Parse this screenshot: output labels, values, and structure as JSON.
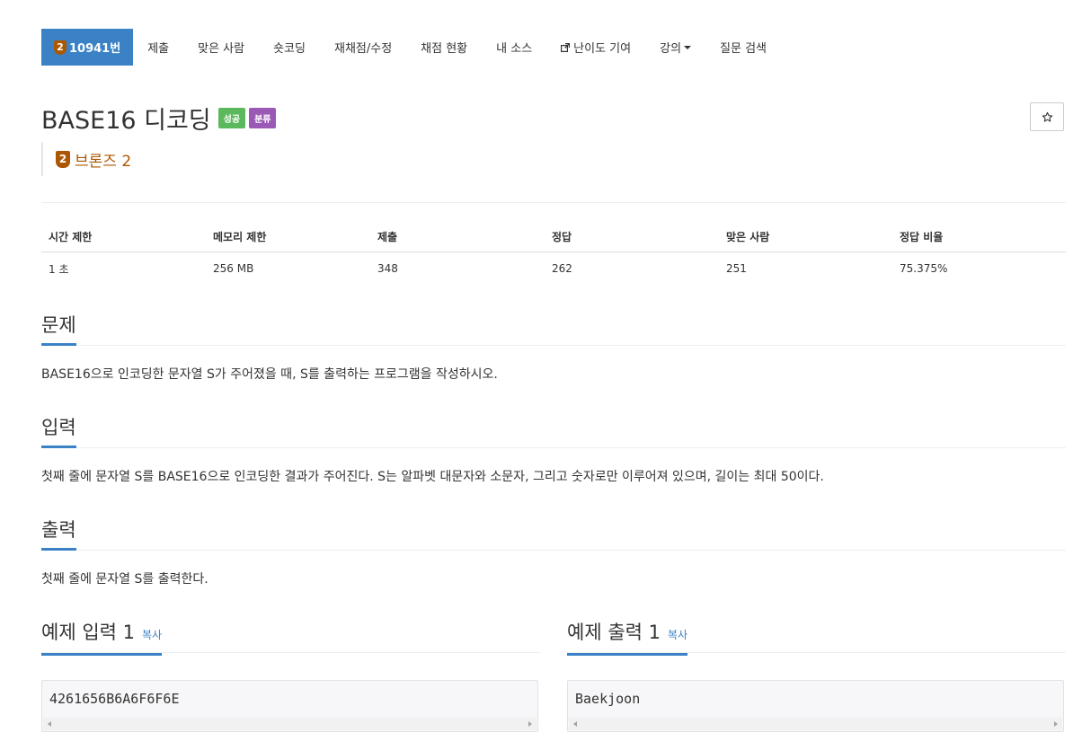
{
  "nav": {
    "tier_number": "2",
    "problem_id": "10941번",
    "items": [
      "제출",
      "맞은 사람",
      "숏코딩",
      "재채점/수정",
      "채점 현황",
      "내 소스",
      "난이도 기여",
      "강의"
    ],
    "last": "질문 검색"
  },
  "problem": {
    "title": "BASE16 디코딩",
    "label_success": "성공",
    "label_category": "분류",
    "tier_number": "2",
    "tier_name": "브론즈 2"
  },
  "stats": {
    "headers": [
      "시간 제한",
      "메모리 제한",
      "제출",
      "정답",
      "맞은 사람",
      "정답 비율"
    ],
    "values": [
      "1 초",
      "256 MB",
      "348",
      "262",
      "251",
      "75.375%"
    ]
  },
  "sections": {
    "problem_title": "문제",
    "problem_body": "BASE16으로 인코딩한 문자열 S가 주어졌을 때, S를 출력하는 프로그램을 작성하시오.",
    "input_title": "입력",
    "input_body": "첫째 줄에 문자열 S를 BASE16으로 인코딩한 결과가 주어진다. S는 알파벳 대문자와 소문자, 그리고 숫자로만 이루어져 있으며, 길이는 최대 50이다.",
    "output_title": "출력",
    "output_body": "첫째 줄에 문자열 S를 출력한다."
  },
  "samples": {
    "input_title": "예제 입력 1",
    "output_title": "예제 출력 1",
    "copy_label": "복사",
    "input_value": "4261656B6A6F6F6E",
    "output_value": "Baekjoon"
  },
  "colors": {
    "accent": "#3a82c5",
    "bronze": "#ad5600",
    "success": "#5cb85c",
    "purple": "#9b59b6"
  }
}
